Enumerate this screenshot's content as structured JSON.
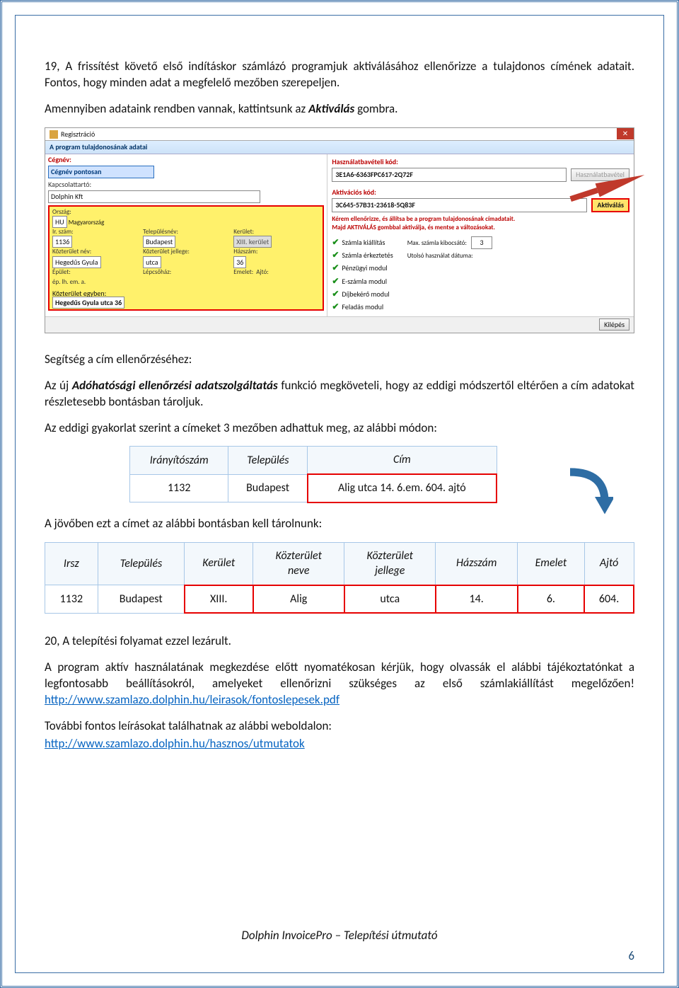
{
  "para1_a": "19, A frissítést követő első indításkor számlázó programjuk aktiválásához ellenőrizze a tulajdonos címének adatait. Fontos, hogy minden adat a megfelelő mezőben szerepeljen.",
  "para2_a": "Amennyiben adataink rendben vannak, kattintsunk az ",
  "para2_b": "Aktiválás",
  "para2_c": " gombra.",
  "regshot": {
    "title": "Regisztráció",
    "subhead": "A program tulajdonosának adatai",
    "left": {
      "label_cegnev": "Cégnév:",
      "cegnev": "Cégnév pontosan",
      "label_kapcs": "Kapcsolattartó:",
      "kapcs": "Dolphin Kft",
      "label_orszag": "Ország:",
      "orszag_code": "HU",
      "orszag": "Magyarország",
      "label_irszam": "Ir. szám:",
      "irszam": "1136",
      "label_telep": "Településnév:",
      "telep": "Budapest",
      "label_kerulet": "Kerület:",
      "kerulet": "XIII. kerület",
      "label_koztnev": "Közterület név:",
      "koztnev": "Hegedűs Gyula",
      "label_koztjel": "Közterület jellege:",
      "koztjel": "utca",
      "label_hazszam": "Házszám:",
      "hazszam": "36",
      "label_epulet": "Épület:",
      "label_lepcso": "Lépcsőház:",
      "label_emelet": "Emelet:",
      "label_ajto": "Ajtó:",
      "row_labels": "ép.        lh.        em.        a.",
      "label_koztegyben": "Közterület egyben:",
      "koztegyben": "Hegedűs Gyula utca 36"
    },
    "right": {
      "label_haszn": "Használatbavételi kód:",
      "haszn": "3E1A6-6363FPC617-2Q72F",
      "btn_haszn": "Használatbavétel",
      "label_akt": "Aktivációs kód:",
      "akt": "3C645-57B31-23618-5Q83F",
      "btn_akt": "Aktiválás",
      "msg1": "Kérem ellenőrizze, és állítsa be a program tulajdonosának címadatait.",
      "msg2": "Majd AKTIVÁLÁS gombbal aktiválja, és mentse a változásokat.",
      "mod1": "Számla kiállítás",
      "mod2": "Számla érkeztetés",
      "mod3": "Pénzügyi modul",
      "mod4": "E-számla modul",
      "mod5": "Díjbekérő modul",
      "mod6": "Feladás modul",
      "label_max": "Max. számla kibocsátó:",
      "max": "3",
      "label_utolso": "Utolsó használat dátuma:"
    },
    "btn_kilepes": "Kilépés"
  },
  "help_heading": "Segítség a cím ellenőrzéséhez:",
  "help_p1_a": "Az új ",
  "help_p1_b": "Adóhatósági ellenőrzési adatszolgáltatás",
  "help_p1_c": " funkció megköveteli, hogy az eddigi módszertől eltérően a cím adatokat részletesebb bontásban tároljuk.",
  "help_p2": "Az eddigi gyakorlat szerint a címeket 3 mezőben adhattuk meg, az alábbi módon:",
  "table1": {
    "h1": "Irányítószám",
    "h2": "Település",
    "h3": "Cím",
    "c1": "1132",
    "c2": "Budapest",
    "c3": "Alig utca 14. 6.em. 604. ajtó"
  },
  "help_p3": "A jövőben ezt a címet az alábbi bontásban kell tárolnunk:",
  "table2": {
    "h1": "Irsz",
    "h2": "Település",
    "h3": "Kerület",
    "h4": "Közterület\nneve",
    "h5": "Közterület\njellege",
    "h6": "Házszám",
    "h7": "Emelet",
    "h8": "Ajtó",
    "c1": "1132",
    "c2": "Budapest",
    "c3": "XIII.",
    "c4": "Alig",
    "c5": "utca",
    "c6": "14.",
    "c7": "6.",
    "c8": "604."
  },
  "para20": "20, A telepítési folyamat ezzel lezárult.",
  "para21_a": "A program aktív használatának megkezdése előtt nyomatékosan kérjük, hogy olvassák el alábbi tájékoztatónkat a legfontosabb beállításokról, amelyeket ellenőrizni szükséges az első számlakiállítást megelőzően! ",
  "link1": "http://www.szamlazo.dolphin.hu/leirasok/fontoslepesek.pdf",
  "para22": "További fontos leírásokat találhatnak az alábbi weboldalon:",
  "link2": "http://www.szamlazo.dolphin.hu/hasznos/utmutatok",
  "footer_title": "Dolphin InvoicePro – Telepítési útmutató",
  "footer_num": "6"
}
